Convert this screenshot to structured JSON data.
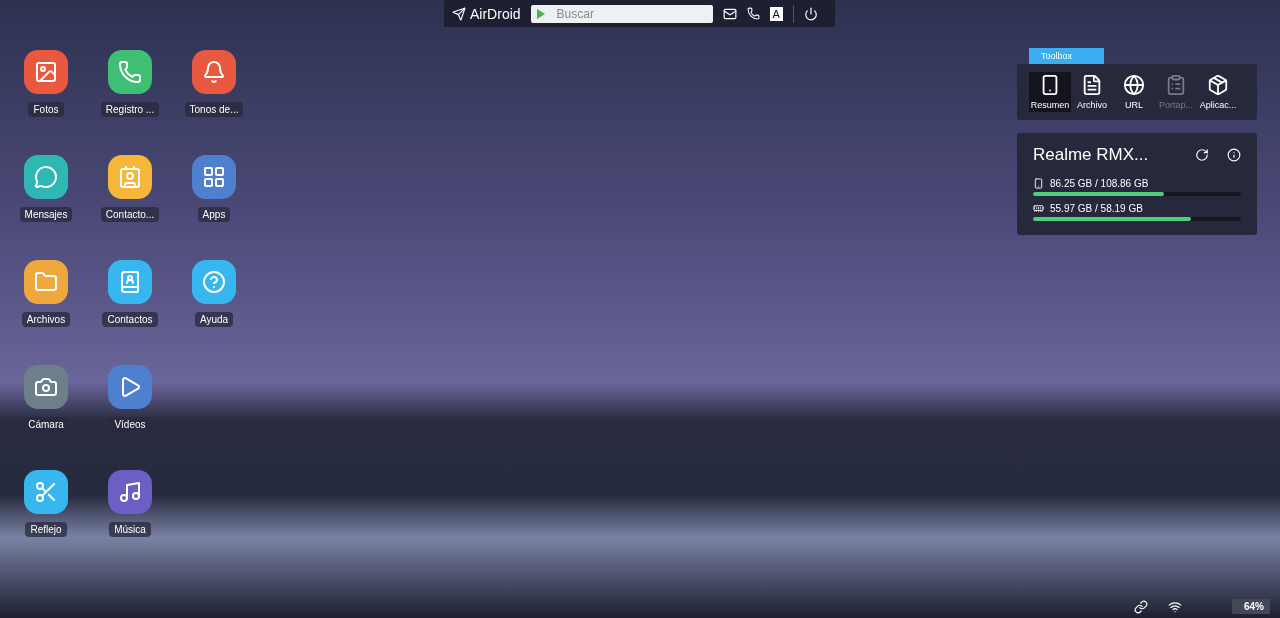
{
  "top_bar": {
    "logo": "AirDroid",
    "search": {
      "placeholder": "Buscar"
    },
    "keyboard_key": "A"
  },
  "app_rows": [
    [
      {
        "label": "Fotos",
        "kind": "photos",
        "color": "#e9593f"
      },
      {
        "label": "Registro ...",
        "kind": "calls",
        "color": "#3fbf74"
      },
      {
        "label": "Tonos de...",
        "kind": "ringtones",
        "color": "#e9593f"
      }
    ],
    [
      {
        "label": "Mensajes",
        "kind": "messages",
        "color": "#2fb7b4"
      },
      {
        "label": "Contacto...",
        "kind": "contact-cards",
        "color": "#f5b63a"
      },
      {
        "label": "Apps",
        "kind": "apps",
        "color": "#4f7fcf"
      }
    ],
    [
      {
        "label": "Archivos",
        "kind": "files",
        "color": "#f0a73c"
      },
      {
        "label": "Contactos",
        "kind": "contacts",
        "color": "#38b6ef"
      },
      {
        "label": "Ayuda",
        "kind": "help",
        "color": "#38b6ef"
      }
    ],
    [
      {
        "label": "Cámara",
        "kind": "camera",
        "color": "#6e7f8c"
      },
      {
        "label": "Vídeos",
        "kind": "videos",
        "color": "#4f7fcf"
      }
    ],
    [
      {
        "label": "Reflejo",
        "kind": "mirror",
        "color": "#38b6ef"
      },
      {
        "label": "Música",
        "kind": "music",
        "color": "#6c5fc4"
      }
    ]
  ],
  "toolbox": {
    "title": "Toolbox",
    "tools": [
      {
        "label": "Resumen",
        "kind": "phone",
        "selected": true,
        "disabled": false
      },
      {
        "label": "Archivo",
        "kind": "file",
        "selected": false,
        "disabled": false
      },
      {
        "label": "URL",
        "kind": "globe",
        "selected": false,
        "disabled": false
      },
      {
        "label": "Portap...",
        "kind": "clipboard",
        "selected": false,
        "disabled": true
      },
      {
        "label": "Aplicac...",
        "kind": "package",
        "selected": false,
        "disabled": false
      }
    ]
  },
  "device": {
    "name": "Realme RMX...",
    "storage": [
      {
        "kind": "phone",
        "reading": "86.25 GB / 108.86 GB",
        "level": 0.63
      },
      {
        "kind": "sd",
        "reading": "55.97 GB / 58.19 GB",
        "level": 0.76
      }
    ]
  },
  "status": {
    "battery": "64%"
  }
}
